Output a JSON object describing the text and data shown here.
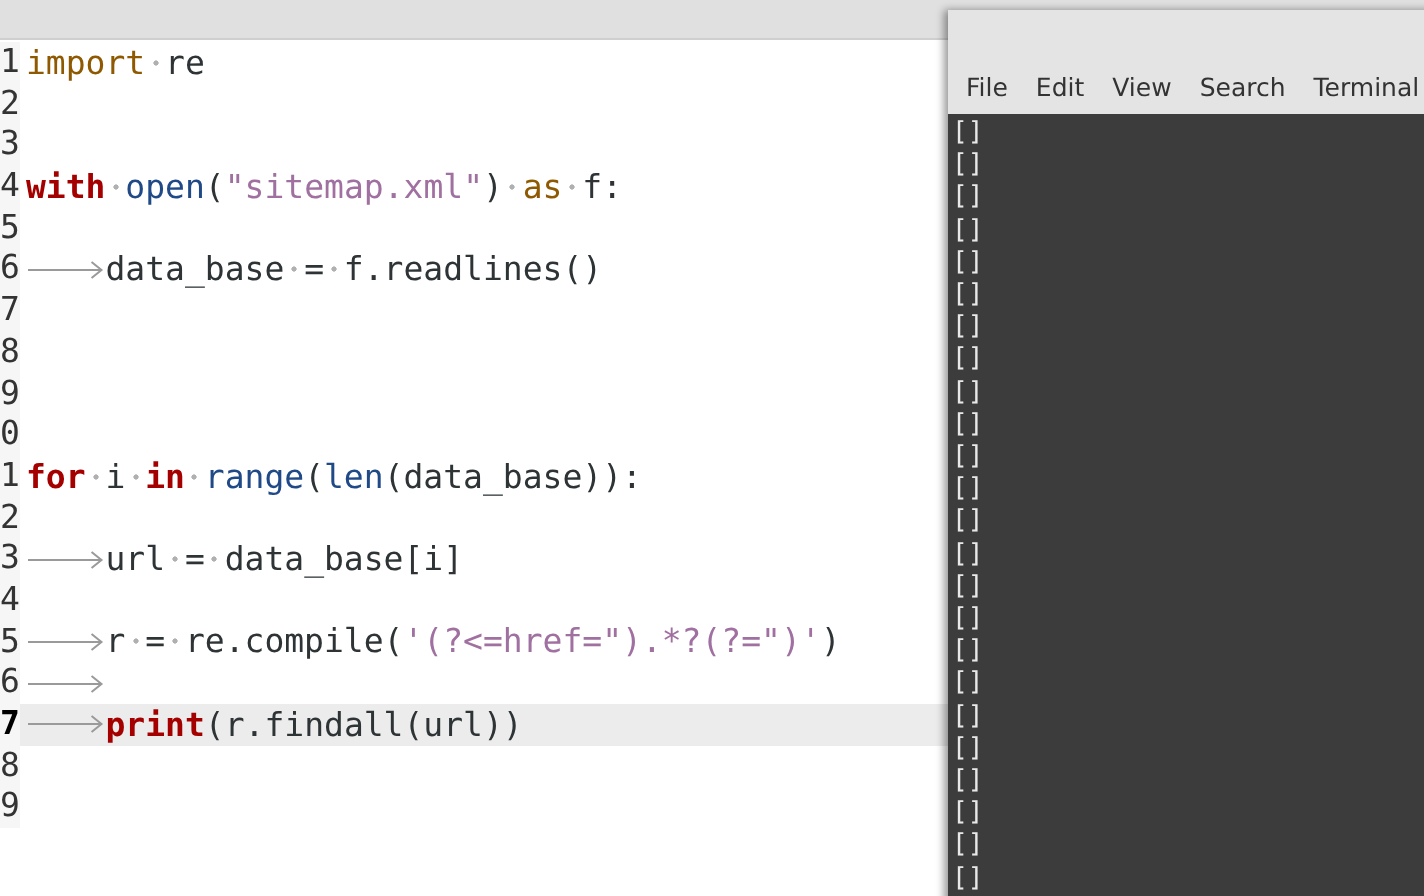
{
  "editor": {
    "lines": [
      {
        "number": "1",
        "current": false,
        "tokens": [
          {
            "kind": "keyword2",
            "text": "import"
          },
          {
            "kind": "space"
          },
          {
            "kind": "text",
            "text": "re"
          }
        ]
      },
      {
        "number": "2",
        "current": false
      },
      {
        "number": "3",
        "current": false
      },
      {
        "number": "4",
        "current": false,
        "tokens": [
          {
            "kind": "keyword",
            "text": "with"
          },
          {
            "kind": "space"
          },
          {
            "kind": "builtin",
            "text": "open"
          },
          {
            "kind": "text",
            "text": "("
          },
          {
            "kind": "string",
            "text": "\"sitemap.xml\""
          },
          {
            "kind": "text",
            "text": ")"
          },
          {
            "kind": "space"
          },
          {
            "kind": "keyword2",
            "text": "as"
          },
          {
            "kind": "space"
          },
          {
            "kind": "text",
            "text": "f:"
          }
        ]
      },
      {
        "number": "5",
        "current": false
      },
      {
        "number": "6",
        "current": false,
        "tokens": [
          {
            "kind": "tab"
          },
          {
            "kind": "text",
            "text": "data_base"
          },
          {
            "kind": "space"
          },
          {
            "kind": "text",
            "text": "="
          },
          {
            "kind": "space"
          },
          {
            "kind": "text",
            "text": "f.readlines()"
          }
        ]
      },
      {
        "number": "7",
        "current": false
      },
      {
        "number": "8",
        "current": false
      },
      {
        "number": "9",
        "current": false
      },
      {
        "number": "0",
        "current": false
      },
      {
        "number": "1",
        "current": false,
        "tokens": [
          {
            "kind": "keyword",
            "text": "for"
          },
          {
            "kind": "space"
          },
          {
            "kind": "text",
            "text": "i"
          },
          {
            "kind": "space"
          },
          {
            "kind": "keyword",
            "text": "in"
          },
          {
            "kind": "space"
          },
          {
            "kind": "builtin",
            "text": "range"
          },
          {
            "kind": "text",
            "text": "("
          },
          {
            "kind": "builtin",
            "text": "len"
          },
          {
            "kind": "text",
            "text": "(data_base)):"
          }
        ]
      },
      {
        "number": "2",
        "current": false
      },
      {
        "number": "3",
        "current": false,
        "tokens": [
          {
            "kind": "tab"
          },
          {
            "kind": "text",
            "text": "url"
          },
          {
            "kind": "space"
          },
          {
            "kind": "text",
            "text": "="
          },
          {
            "kind": "space"
          },
          {
            "kind": "text",
            "text": "data_base[i]"
          }
        ]
      },
      {
        "number": "4",
        "current": false
      },
      {
        "number": "5",
        "current": false,
        "tokens": [
          {
            "kind": "tab"
          },
          {
            "kind": "text",
            "text": "r"
          },
          {
            "kind": "space"
          },
          {
            "kind": "text",
            "text": "="
          },
          {
            "kind": "space"
          },
          {
            "kind": "text",
            "text": "re.compile("
          },
          {
            "kind": "string",
            "text": "'(?<=href=\").*?(?=\")'"
          },
          {
            "kind": "text",
            "text": ")"
          }
        ]
      },
      {
        "number": "6",
        "current": false,
        "tokens": [
          {
            "kind": "tab"
          }
        ]
      },
      {
        "number": "7",
        "current": true,
        "tokens": [
          {
            "kind": "tab"
          },
          {
            "kind": "keyword",
            "text": "print"
          },
          {
            "kind": "text",
            "text": "(r.findall(url))"
          }
        ]
      },
      {
        "number": "8",
        "current": false
      },
      {
        "number": "9",
        "current": false
      }
    ]
  },
  "terminal": {
    "menu": [
      "File",
      "Edit",
      "View",
      "Search",
      "Terminal"
    ],
    "output": [
      "[]",
      "[]",
      "[]",
      "[]",
      "[]",
      "[]",
      "[]",
      "[]",
      "[]",
      "[]",
      "[]",
      "[]",
      "[]",
      "[]",
      "[]",
      "[]",
      "[]",
      "[]",
      "[]",
      "[]",
      "[]",
      "[]",
      "[]",
      "[]"
    ]
  }
}
